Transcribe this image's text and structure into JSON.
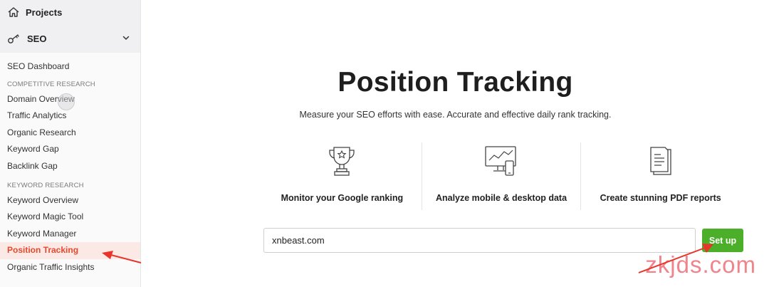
{
  "sidebar": {
    "projects_label": "Projects",
    "seo_label": "SEO",
    "dashboard": "SEO Dashboard",
    "competitive_header": "COMPETITIVE RESEARCH",
    "competitive_items": [
      "Domain Overview",
      "Traffic Analytics",
      "Organic Research",
      "Keyword Gap",
      "Backlink Gap"
    ],
    "keyword_header": "KEYWORD RESEARCH",
    "keyword_items": [
      "Keyword Overview",
      "Keyword Magic Tool",
      "Keyword Manager",
      "Position Tracking",
      "Organic Traffic Insights"
    ],
    "active_item": "Position Tracking"
  },
  "main": {
    "title": "Position Tracking",
    "subtitle": "Measure your SEO efforts with ease. Accurate and effective daily rank tracking.",
    "features": [
      "Monitor your Google ranking",
      "Analyze mobile & desktop data",
      "Create stunning PDF reports"
    ],
    "domain_value": "xnbeast.com",
    "setup_label": "Set up"
  },
  "watermark": "zkjds.com",
  "colors": {
    "accent": "#e8472a",
    "button": "#4caf2a",
    "arrow": "#e8352a"
  }
}
